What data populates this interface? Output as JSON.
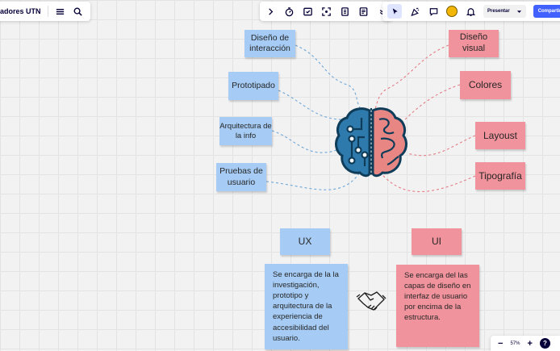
{
  "app": {
    "board_name": "adores UTN",
    "present_label": "Presentar",
    "share_label": "Compartir",
    "zoom_level": "57%"
  },
  "icons": {
    "left_toolbar": [
      "menu-icon",
      "search-icon"
    ],
    "mid_toolbar": [
      "chevron-right-icon",
      "timer-icon",
      "voting-icon",
      "frame-icon",
      "reactions-icon",
      "notes-icon",
      "more-icon"
    ],
    "right_toolbar": [
      "select-cursor-icon",
      "celebrate-icon",
      "comment-icon",
      "notification-bell-icon"
    ]
  },
  "colors": {
    "blue_note": "#a6ccf5",
    "pink_note": "#f1939c",
    "brain_outline": "#0f3d59",
    "brain_left": "#2f7aad",
    "brain_right": "#e88684",
    "share_button": "#4262ff"
  },
  "board": {
    "ux_notes": [
      {
        "text": "Diseño de interacción"
      },
      {
        "text": "Prototipado"
      },
      {
        "text": "Arquitectura de la info"
      },
      {
        "text": "Pruebas de usuario"
      }
    ],
    "ui_notes": [
      {
        "text": "Diseño visual"
      },
      {
        "text": "Colores"
      },
      {
        "text": "Layoust"
      },
      {
        "text": "Tipografía"
      }
    ],
    "ux_title": "UX",
    "ui_title": "UI",
    "ux_body": "Se encarga de la la investigación, prototipo y arquitectura de la experiencia de accesibilidad del usuario.",
    "ui_body": "Se encarga del las capas de diseño en interfaz de usuario por encima de la estructura."
  }
}
